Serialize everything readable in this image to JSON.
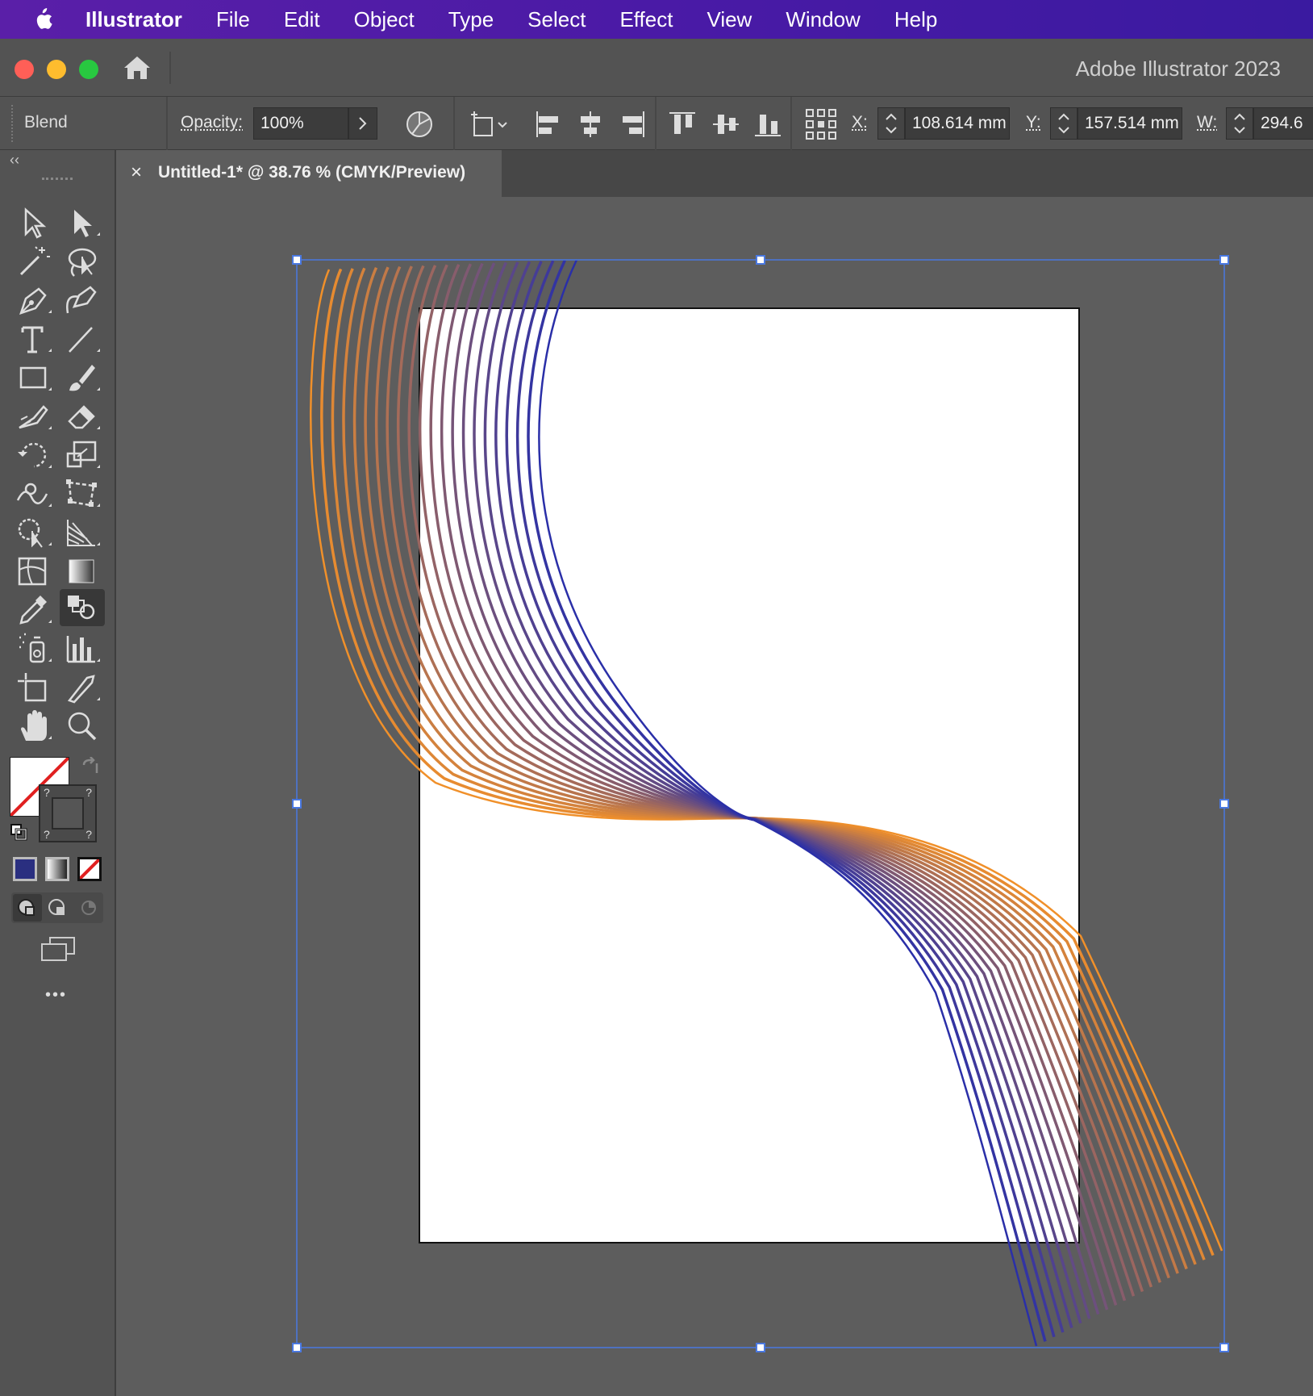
{
  "menubar": {
    "app": "Illustrator",
    "items": [
      "File",
      "Edit",
      "Object",
      "Type",
      "Select",
      "Effect",
      "View",
      "Window",
      "Help"
    ]
  },
  "titlebar": {
    "title": "Adobe Illustrator 2023"
  },
  "controlbar": {
    "selection_label": "Blend",
    "opacity_label": "Opacity:",
    "opacity_value": "100%",
    "x_label": "X:",
    "x_value": "108.614 mm",
    "y_label": "Y:",
    "y_value": "157.514 mm",
    "w_label": "W:",
    "w_value": "294.6"
  },
  "document_tab": {
    "close": "×",
    "title": "Untitled-1* @ 38.76 % (CMYK/Preview)"
  },
  "toolpanel": {
    "collapse": "‹‹",
    "more": "•••",
    "tools": [
      "selection-tool-icon",
      "direct-selection-tool-icon",
      "magic-wand-tool-icon",
      "lasso-tool-icon",
      "pen-tool-icon",
      "curvature-tool-icon",
      "type-tool-icon",
      "line-segment-tool-icon",
      "rectangle-tool-icon",
      "paintbrush-tool-icon",
      "shaper-tool-icon",
      "eraser-tool-icon",
      "rotate-tool-icon",
      "scale-tool-icon",
      "warp-tool-icon",
      "free-transform-tool-icon",
      "shape-builder-tool-icon",
      "perspective-grid-tool-icon",
      "mesh-tool-icon",
      "gradient-tool-icon",
      "eyedropper-tool-icon",
      "blend-tool-icon",
      "symbol-sprayer-tool-icon",
      "column-graph-tool-icon",
      "artboard-tool-icon",
      "slice-tool-icon",
      "hand-tool-icon",
      "zoom-tool-icon"
    ],
    "active_tool": "blend-tool-icon"
  },
  "colors": {
    "menubar": "#4a1aa6",
    "blend_start": "#f0902a",
    "blend_end": "#2a2fa8",
    "selection": "#4a78e0",
    "artboard": "#ffffff"
  }
}
